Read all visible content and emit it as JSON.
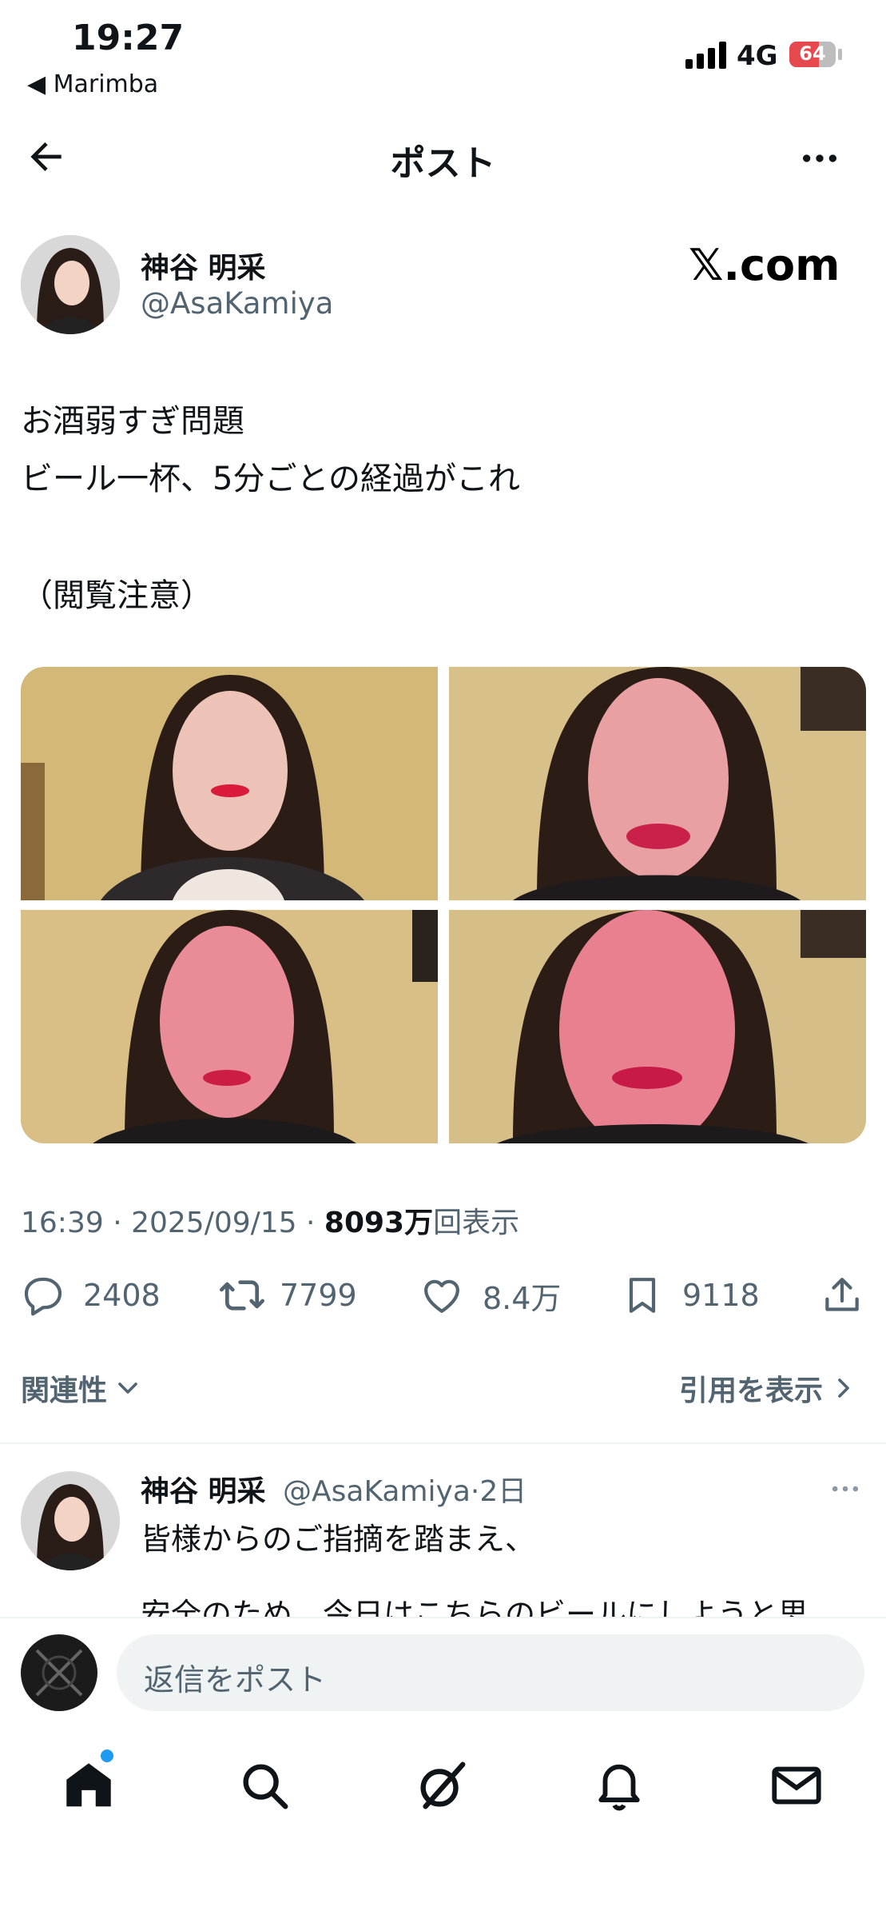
{
  "status_bar": {
    "time": "19:27",
    "back_app": "◀ Marimba",
    "network": "4G",
    "battery": "64"
  },
  "header": {
    "title": "ポスト"
  },
  "author": {
    "name": "神谷 明采",
    "handle": "@AsaKamiya",
    "badge": "𝕏.com"
  },
  "post": {
    "lines": [
      "お酒弱すぎ問題",
      "ビール一杯、5分ごとの経過がこれ",
      "（閲覧注意）"
    ],
    "time": "16:39 · 2025/09/15 · ",
    "views_number": "8093万",
    "views_label": "回表示"
  },
  "actions": {
    "replies": "2408",
    "reposts": "7799",
    "likes": "8.4万",
    "bookmarks": "9118"
  },
  "sort": {
    "label": "関連性",
    "quotes": "引用を表示"
  },
  "reply": {
    "name": "神谷 明采",
    "handle": "@AsaKamiya",
    "sep": "·",
    "age": "2日",
    "line1": "皆様からのご指摘を踏まえ、",
    "line2": "安全のため、今日はこちらのビールにしようと思"
  },
  "composer": {
    "placeholder": "返信をポスト"
  },
  "colors": {
    "accent": "#1d9bf0",
    "text": "#0f1419",
    "muted": "#536471"
  },
  "icons": [
    "back-arrow-icon",
    "more-icon",
    "reply-icon",
    "repost-icon",
    "like-icon",
    "bookmark-icon",
    "share-icon",
    "chevron-down-icon",
    "chevron-right-icon",
    "home-icon",
    "search-icon",
    "grok-icon",
    "notifications-icon",
    "messages-icon"
  ]
}
